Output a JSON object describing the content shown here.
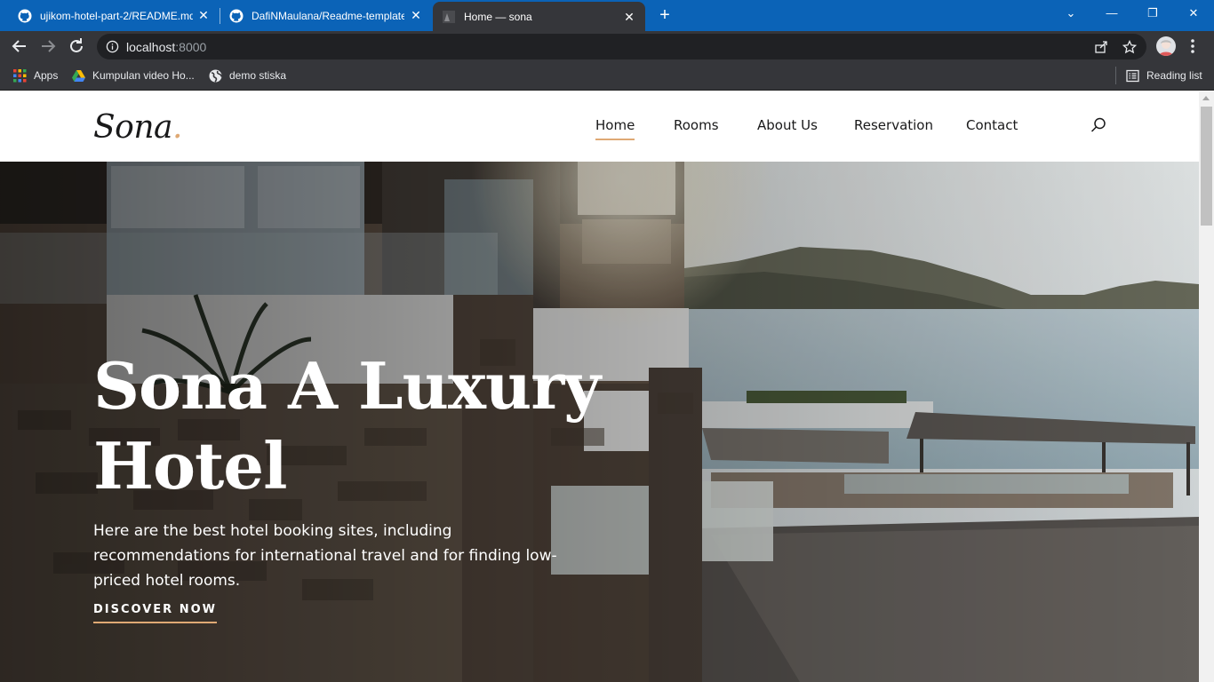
{
  "browser": {
    "tabs": [
      {
        "title": "ujikom-hotel-part-2/README.md",
        "icon": "github-icon"
      },
      {
        "title": "DafiNMaulana/Readme-template",
        "icon": "github-icon"
      },
      {
        "title": "Home — sona",
        "icon": "site-favicon"
      }
    ],
    "address": {
      "host": "localhost",
      "port": ":8000"
    },
    "bookmarks": [
      {
        "label": "Apps",
        "icon": "apps-grid-icon"
      },
      {
        "label": "Kumpulan video Ho...",
        "icon": "google-drive-icon"
      },
      {
        "label": "demo stiska",
        "icon": "globe-icon"
      }
    ],
    "reading_list": "Reading list"
  },
  "site": {
    "logo": "Sona",
    "logo_dot": ".",
    "nav": [
      {
        "label": "Home",
        "active": true
      },
      {
        "label": "Rooms"
      },
      {
        "label": "About Us"
      },
      {
        "label": "Reservation"
      },
      {
        "label": "Contact"
      }
    ]
  },
  "hero": {
    "title_line1": "Sona A Luxury",
    "title_line2": "Hotel",
    "subtitle": "Here are the best hotel booking sites, including recommendations for international travel and for finding low-priced hotel rooms.",
    "cta": "DISCOVER NOW"
  },
  "colors": {
    "accent": "#dfa974",
    "tabstrip": "#0b63b7",
    "chrome": "#35363a"
  }
}
